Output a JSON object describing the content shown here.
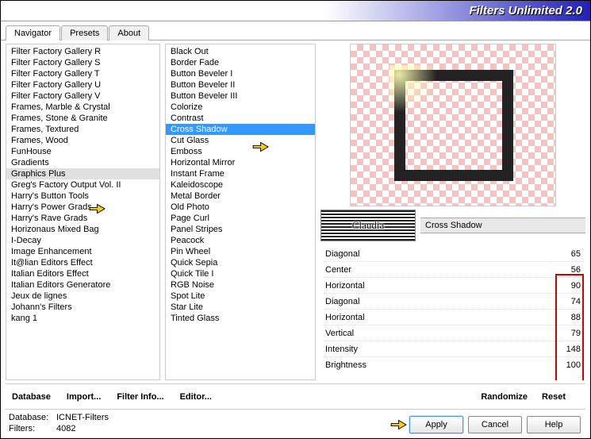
{
  "title": "Filters Unlimited 2.0",
  "tabs": {
    "navigator": "Navigator",
    "presets": "Presets",
    "about": "About"
  },
  "categories": [
    "Filter Factory Gallery R",
    "Filter Factory Gallery S",
    "Filter Factory Gallery T",
    "Filter Factory Gallery U",
    "Filter Factory Gallery V",
    "Frames, Marble & Crystal",
    "Frames, Stone & Granite",
    "Frames, Textured",
    "Frames, Wood",
    "FunHouse",
    "Gradients",
    "Graphics Plus",
    "Greg's Factory Output Vol. II",
    "Harry's Button Tools",
    "Harry's Power Grads",
    "Harry's Rave Grads",
    "Horizonaus Mixed Bag",
    "I-Decay",
    "Image Enhancement",
    "It@lian Editors Effect",
    "Italian Editors Effect",
    "Italian Editors Generatore",
    "Jeux de lignes",
    "Johann's Filters",
    "kang 1"
  ],
  "selectedCategoryIndex": 11,
  "filters": [
    "Black Out",
    "Border Fade",
    "Button Beveler I",
    "Button Beveler II",
    "Button Beveler III",
    "Colorize",
    "Contrast",
    "Cross Shadow",
    "Cut Glass",
    "Emboss",
    "Horizontal Mirror",
    "Instant Frame",
    "Kaleidoscope",
    "Metal Border",
    "Old Photo",
    "Page Curl",
    "Panel Stripes",
    "Peacock",
    "Pin Wheel",
    "Quick Sepia",
    "Quick Tile I",
    "RGB Noise",
    "Spot Lite",
    "Star Lite",
    "Tinted Glass"
  ],
  "selectedFilterIndex": 7,
  "claudiaBadge": "Claudia",
  "filterNameLabel": "Cross Shadow",
  "params": [
    {
      "label": "Diagonal",
      "value": "65"
    },
    {
      "label": "Center",
      "value": "56"
    },
    {
      "label": "Horizontal",
      "value": "90"
    },
    {
      "label": "Diagonal",
      "value": "74"
    },
    {
      "label": "Horizontal",
      "value": "88"
    },
    {
      "label": "Vertical",
      "value": "79"
    },
    {
      "label": "Intensity",
      "value": "148"
    },
    {
      "label": "Brightness",
      "value": "100"
    }
  ],
  "bottom": {
    "database": "Database",
    "import": "Import...",
    "filterinfo": "Filter Info...",
    "editor": "Editor...",
    "randomize": "Randomize",
    "reset": "Reset"
  },
  "status": {
    "dbLabel": "Database:",
    "dbValue": "ICNET-Filters",
    "filtersLabel": "Filters:",
    "filtersValue": "4082"
  },
  "buttons": {
    "apply": "Apply",
    "cancel": "Cancel",
    "help": "Help"
  }
}
